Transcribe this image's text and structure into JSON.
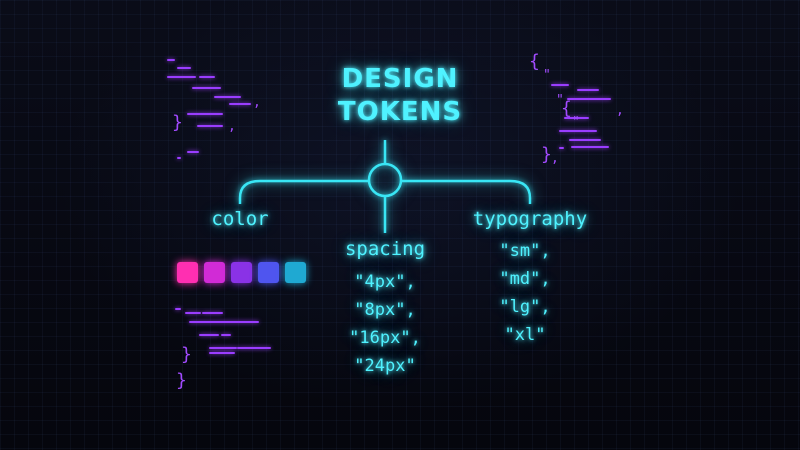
{
  "title": {
    "line1": "DESIGN",
    "line2": "TOKENS"
  },
  "branches": {
    "color": {
      "label": "color",
      "swatches": [
        "#ff2fb1",
        "#d12bd6",
        "#8a32e6",
        "#4f55ef",
        "#1fa9d2"
      ]
    },
    "spacing": {
      "label": "spacing",
      "values": [
        "\"4px\",",
        "\"8px\",",
        "\"16px\",",
        "\"24px\""
      ]
    },
    "typography": {
      "label": "typography",
      "values": [
        "\"sm\",",
        "\"md\",",
        "\"lg\",",
        "\"xl\""
      ]
    }
  },
  "colors": {
    "accent": "#4ff2ff",
    "deco": "#9a3dff",
    "background": "#05060d"
  }
}
